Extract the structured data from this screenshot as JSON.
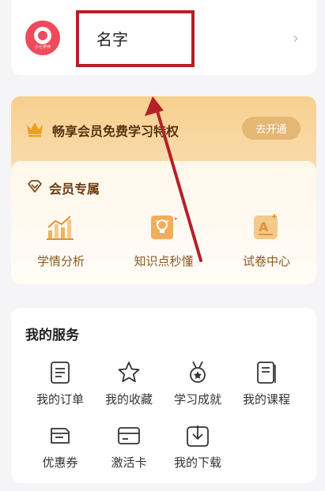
{
  "profile": {
    "name": "名字",
    "avatar_tag": "小七学伴"
  },
  "vip": {
    "title": "畅享会员免费学习特权",
    "open_button": "去开通"
  },
  "member": {
    "title": "会员专属",
    "features": [
      {
        "label": "学情分析",
        "icon": "chart-icon"
      },
      {
        "label": "知识点秒懂",
        "icon": "lightbulb-icon"
      },
      {
        "label": "试卷中心",
        "icon": "exam-paper-icon"
      }
    ]
  },
  "services": {
    "title": "我的服务",
    "items": [
      {
        "label": "我的订单",
        "icon": "order-icon"
      },
      {
        "label": "我的收藏",
        "icon": "star-icon"
      },
      {
        "label": "学习成就",
        "icon": "medal-icon"
      },
      {
        "label": "我的课程",
        "icon": "course-icon"
      },
      {
        "label": "优惠券",
        "icon": "coupon-icon"
      },
      {
        "label": "激活卡",
        "icon": "card-icon"
      },
      {
        "label": "我的下载",
        "icon": "download-icon"
      }
    ]
  },
  "colors": {
    "accent_red": "#ef4a5c",
    "highlight_box": "#b4202a",
    "gold_button": "#e5b775",
    "gold_text": "#8a5a24"
  }
}
